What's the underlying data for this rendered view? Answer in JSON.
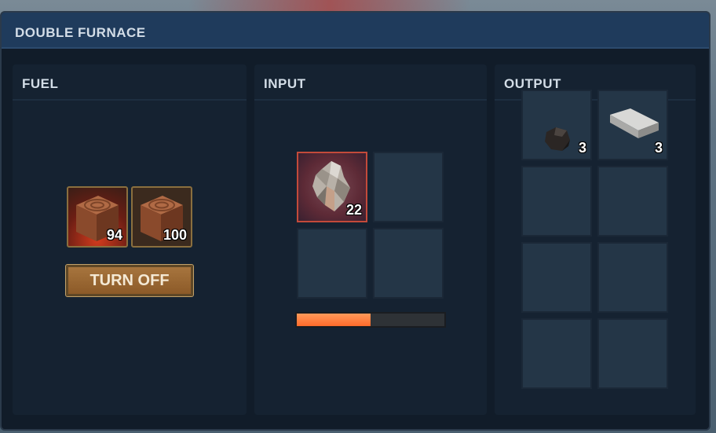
{
  "window": {
    "title": "DOUBLE FURNACE"
  },
  "fuel": {
    "label": "FUEL",
    "slots": [
      {
        "item": "wood-log-icon",
        "count": "94",
        "burning": true
      },
      {
        "item": "wood-log-icon",
        "count": "100",
        "burning": false
      }
    ],
    "button_label": "TURN OFF"
  },
  "input": {
    "label": "INPUT",
    "slots": [
      {
        "item": "ore-crystal-icon",
        "count": "22",
        "smelting": true
      },
      {
        "item": "",
        "count": ""
      },
      {
        "item": "",
        "count": ""
      },
      {
        "item": "",
        "count": ""
      }
    ],
    "progress": 0.5
  },
  "output": {
    "label": "OUTPUT",
    "slots": [
      {
        "item": "coal-icon",
        "count": "3"
      },
      {
        "item": "metal-bar-icon",
        "count": "3"
      },
      {
        "item": "",
        "count": ""
      },
      {
        "item": "",
        "count": ""
      },
      {
        "item": "",
        "count": ""
      },
      {
        "item": "",
        "count": ""
      },
      {
        "item": "",
        "count": ""
      },
      {
        "item": "",
        "count": ""
      }
    ]
  },
  "colors": {
    "accent": "#ff7a3a",
    "button": "#9a6733",
    "panel": "#152231",
    "titlebar": "#1f3b5c"
  }
}
